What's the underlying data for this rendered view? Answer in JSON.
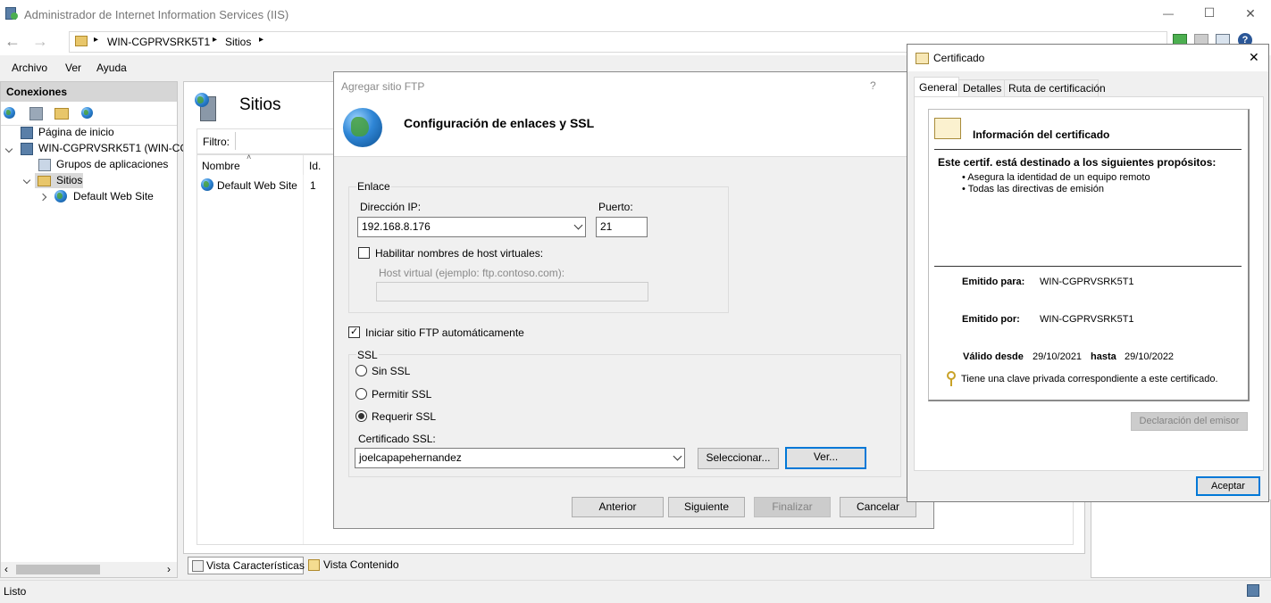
{
  "window": {
    "title": "Administrador de Internet Information Services (IIS)",
    "controls": {
      "minimize": "—",
      "maximize": "☐",
      "close": "✕"
    }
  },
  "address_bar": {
    "crumbs": [
      "WIN-CGPRVSRK5T1",
      "Sitios"
    ],
    "separator": "▸"
  },
  "menu": [
    "Archivo",
    "Ver",
    "Ayuda"
  ],
  "connections": {
    "title": "Conexiones",
    "tree": [
      {
        "label": "Página de inicio"
      },
      {
        "label": "WIN-CGPRVSRK5T1 (WIN-CG"
      },
      {
        "label": "Grupos de aplicaciones"
      },
      {
        "label": "Sitios"
      },
      {
        "label": "Default Web Site"
      }
    ]
  },
  "sites_panel": {
    "title": "Sitios",
    "filter_label": "Filtro:",
    "columns": [
      "Nombre",
      "Id."
    ],
    "rows": [
      {
        "name": "Default Web Site",
        "id": "1"
      }
    ]
  },
  "bottom_tabs": [
    "Vista Características",
    "Vista Contenido"
  ],
  "status_bar": "Listo",
  "ftp_dialog": {
    "title": "Agregar sitio FTP",
    "help": "?",
    "heading": "Configuración de enlaces y SSL",
    "binding_group": "Enlace",
    "ip_label": "Dirección IP:",
    "ip_value": "192.168.8.176",
    "port_label": "Puerto:",
    "port_value": "21",
    "virtual_hosts_label": "Habilitar nombres de host virtuales:",
    "virtual_host_label": "Host virtual (ejemplo: ftp.contoso.com):",
    "virtual_host_value": "",
    "autostart_label": "Iniciar sitio FTP automáticamente",
    "ssl_group": "SSL",
    "ssl_options": [
      "Sin SSL",
      "Permitir SSL",
      "Requerir SSL"
    ],
    "ssl_selected": "Requerir SSL",
    "cert_label": "Certificado SSL:",
    "cert_value": "joelcapapehernandez",
    "select_button": "Seleccionar...",
    "view_button": "Ver...",
    "buttons": {
      "prev": "Anterior",
      "next": "Siguiente",
      "finish": "Finalizar",
      "cancel": "Cancelar"
    }
  },
  "cert_dialog": {
    "title": "Certificado",
    "close": "✕",
    "tabs": [
      "General",
      "Detalles",
      "Ruta de certificación"
    ],
    "info_title": "Información del certificado",
    "purpose_heading": "Este certif. está destinado a los siguientes propósitos:",
    "purposes": [
      "• Asegura la identidad de un equipo remoto",
      "• Todas las directivas de emisión"
    ],
    "issued_to_label": "Emitido para:",
    "issued_to_value": "WIN-CGPRVSRK5T1",
    "issued_by_label": "Emitido por:",
    "issued_by_value": "WIN-CGPRVSRK5T1",
    "valid_from_label": "Válido desde",
    "valid_from_value": "29/10/2021",
    "valid_to_label": "hasta",
    "valid_to_value": "29/10/2022",
    "private_key_note": "Tiene una clave privada correspondiente a este certificado.",
    "issuer_statement": "Declaración del emisor",
    "ok": "Aceptar"
  },
  "colors": {
    "accent": "#0078d7",
    "panel_header": "#d6d6d6"
  }
}
